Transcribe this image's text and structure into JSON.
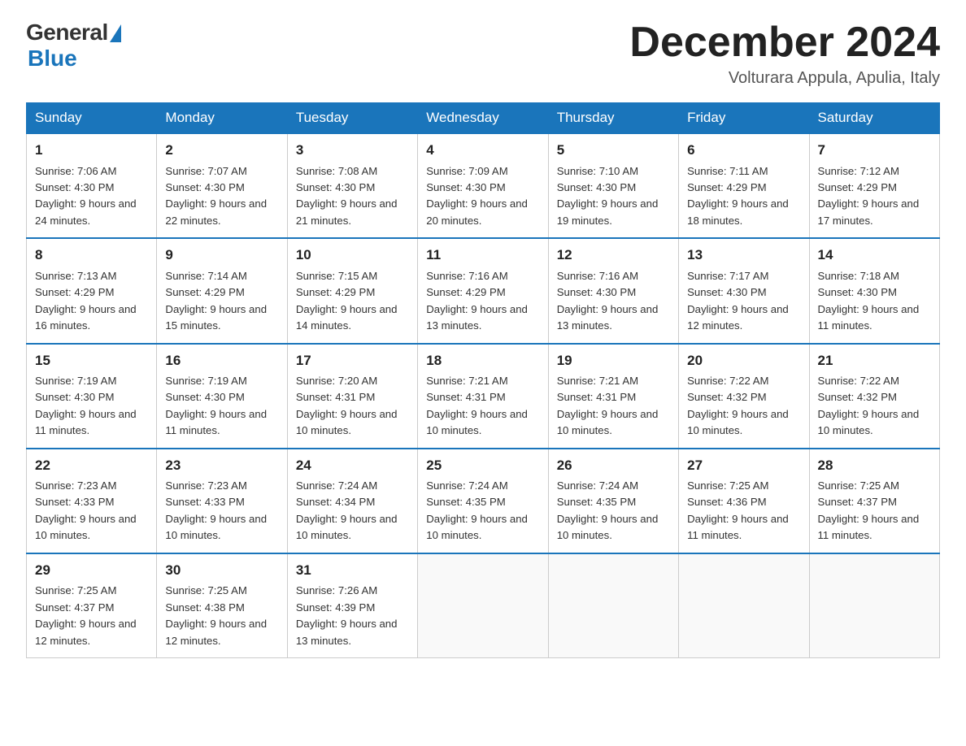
{
  "logo": {
    "general": "General",
    "blue": "Blue"
  },
  "header": {
    "month": "December 2024",
    "location": "Volturara Appula, Apulia, Italy"
  },
  "weekdays": [
    "Sunday",
    "Monday",
    "Tuesday",
    "Wednesday",
    "Thursday",
    "Friday",
    "Saturday"
  ],
  "weeks": [
    [
      {
        "day": "1",
        "sunrise": "7:06 AM",
        "sunset": "4:30 PM",
        "daylight": "9 hours and 24 minutes."
      },
      {
        "day": "2",
        "sunrise": "7:07 AM",
        "sunset": "4:30 PM",
        "daylight": "9 hours and 22 minutes."
      },
      {
        "day": "3",
        "sunrise": "7:08 AM",
        "sunset": "4:30 PM",
        "daylight": "9 hours and 21 minutes."
      },
      {
        "day": "4",
        "sunrise": "7:09 AM",
        "sunset": "4:30 PM",
        "daylight": "9 hours and 20 minutes."
      },
      {
        "day": "5",
        "sunrise": "7:10 AM",
        "sunset": "4:30 PM",
        "daylight": "9 hours and 19 minutes."
      },
      {
        "day": "6",
        "sunrise": "7:11 AM",
        "sunset": "4:29 PM",
        "daylight": "9 hours and 18 minutes."
      },
      {
        "day": "7",
        "sunrise": "7:12 AM",
        "sunset": "4:29 PM",
        "daylight": "9 hours and 17 minutes."
      }
    ],
    [
      {
        "day": "8",
        "sunrise": "7:13 AM",
        "sunset": "4:29 PM",
        "daylight": "9 hours and 16 minutes."
      },
      {
        "day": "9",
        "sunrise": "7:14 AM",
        "sunset": "4:29 PM",
        "daylight": "9 hours and 15 minutes."
      },
      {
        "day": "10",
        "sunrise": "7:15 AM",
        "sunset": "4:29 PM",
        "daylight": "9 hours and 14 minutes."
      },
      {
        "day": "11",
        "sunrise": "7:16 AM",
        "sunset": "4:29 PM",
        "daylight": "9 hours and 13 minutes."
      },
      {
        "day": "12",
        "sunrise": "7:16 AM",
        "sunset": "4:30 PM",
        "daylight": "9 hours and 13 minutes."
      },
      {
        "day": "13",
        "sunrise": "7:17 AM",
        "sunset": "4:30 PM",
        "daylight": "9 hours and 12 minutes."
      },
      {
        "day": "14",
        "sunrise": "7:18 AM",
        "sunset": "4:30 PM",
        "daylight": "9 hours and 11 minutes."
      }
    ],
    [
      {
        "day": "15",
        "sunrise": "7:19 AM",
        "sunset": "4:30 PM",
        "daylight": "9 hours and 11 minutes."
      },
      {
        "day": "16",
        "sunrise": "7:19 AM",
        "sunset": "4:30 PM",
        "daylight": "9 hours and 11 minutes."
      },
      {
        "day": "17",
        "sunrise": "7:20 AM",
        "sunset": "4:31 PM",
        "daylight": "9 hours and 10 minutes."
      },
      {
        "day": "18",
        "sunrise": "7:21 AM",
        "sunset": "4:31 PM",
        "daylight": "9 hours and 10 minutes."
      },
      {
        "day": "19",
        "sunrise": "7:21 AM",
        "sunset": "4:31 PM",
        "daylight": "9 hours and 10 minutes."
      },
      {
        "day": "20",
        "sunrise": "7:22 AM",
        "sunset": "4:32 PM",
        "daylight": "9 hours and 10 minutes."
      },
      {
        "day": "21",
        "sunrise": "7:22 AM",
        "sunset": "4:32 PM",
        "daylight": "9 hours and 10 minutes."
      }
    ],
    [
      {
        "day": "22",
        "sunrise": "7:23 AM",
        "sunset": "4:33 PM",
        "daylight": "9 hours and 10 minutes."
      },
      {
        "day": "23",
        "sunrise": "7:23 AM",
        "sunset": "4:33 PM",
        "daylight": "9 hours and 10 minutes."
      },
      {
        "day": "24",
        "sunrise": "7:24 AM",
        "sunset": "4:34 PM",
        "daylight": "9 hours and 10 minutes."
      },
      {
        "day": "25",
        "sunrise": "7:24 AM",
        "sunset": "4:35 PM",
        "daylight": "9 hours and 10 minutes."
      },
      {
        "day": "26",
        "sunrise": "7:24 AM",
        "sunset": "4:35 PM",
        "daylight": "9 hours and 10 minutes."
      },
      {
        "day": "27",
        "sunrise": "7:25 AM",
        "sunset": "4:36 PM",
        "daylight": "9 hours and 11 minutes."
      },
      {
        "day": "28",
        "sunrise": "7:25 AM",
        "sunset": "4:37 PM",
        "daylight": "9 hours and 11 minutes."
      }
    ],
    [
      {
        "day": "29",
        "sunrise": "7:25 AM",
        "sunset": "4:37 PM",
        "daylight": "9 hours and 12 minutes."
      },
      {
        "day": "30",
        "sunrise": "7:25 AM",
        "sunset": "4:38 PM",
        "daylight": "9 hours and 12 minutes."
      },
      {
        "day": "31",
        "sunrise": "7:26 AM",
        "sunset": "4:39 PM",
        "daylight": "9 hours and 13 minutes."
      },
      null,
      null,
      null,
      null
    ]
  ]
}
